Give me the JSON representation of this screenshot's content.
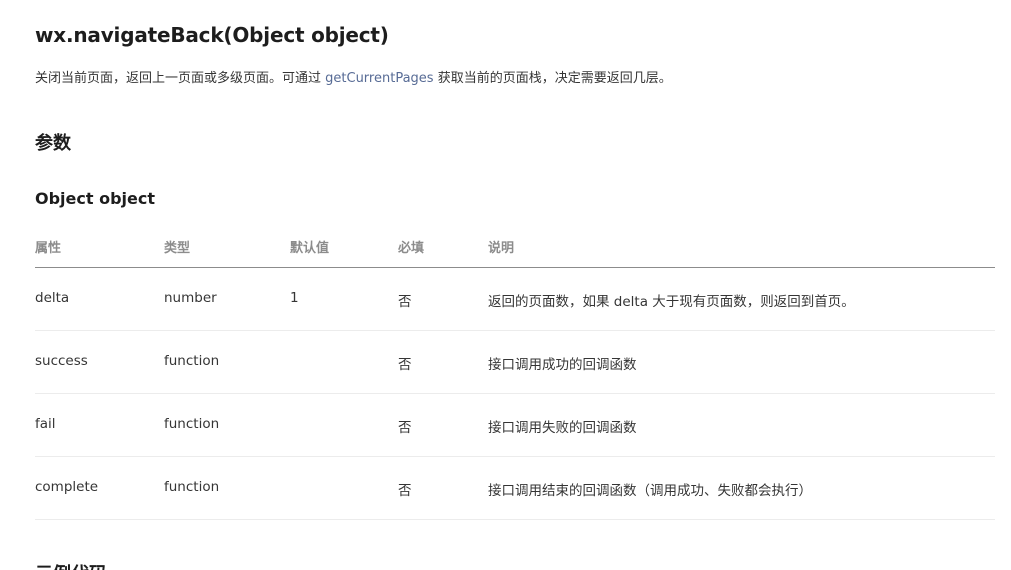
{
  "doc": {
    "api_title": "wx.navigateBack(Object object)",
    "description": {
      "before_link": "关闭当前页面，返回上一页面或多级页面。可通过 ",
      "link_text": "getCurrentPages",
      "after_link": " 获取当前的页面栈，决定需要返回几层。"
    },
    "section_title": "参数",
    "sub_title": "Object object",
    "table": {
      "headers": [
        "属性",
        "类型",
        "默认值",
        "必填",
        "说明"
      ],
      "rows": [
        [
          "delta",
          "number",
          "1",
          "否",
          "返回的页面数，如果 delta 大于现有页面数，则返回到首页。"
        ],
        [
          "success",
          "function",
          "",
          "否",
          "接口调用成功的回调函数"
        ],
        [
          "fail",
          "function",
          "",
          "否",
          "接口调用失败的回调函数"
        ],
        [
          "complete",
          "function",
          "",
          "否",
          "接口调用结束的回调函数（调用成功、失败都会执行）"
        ]
      ]
    },
    "next_section_title": "示例代码"
  }
}
